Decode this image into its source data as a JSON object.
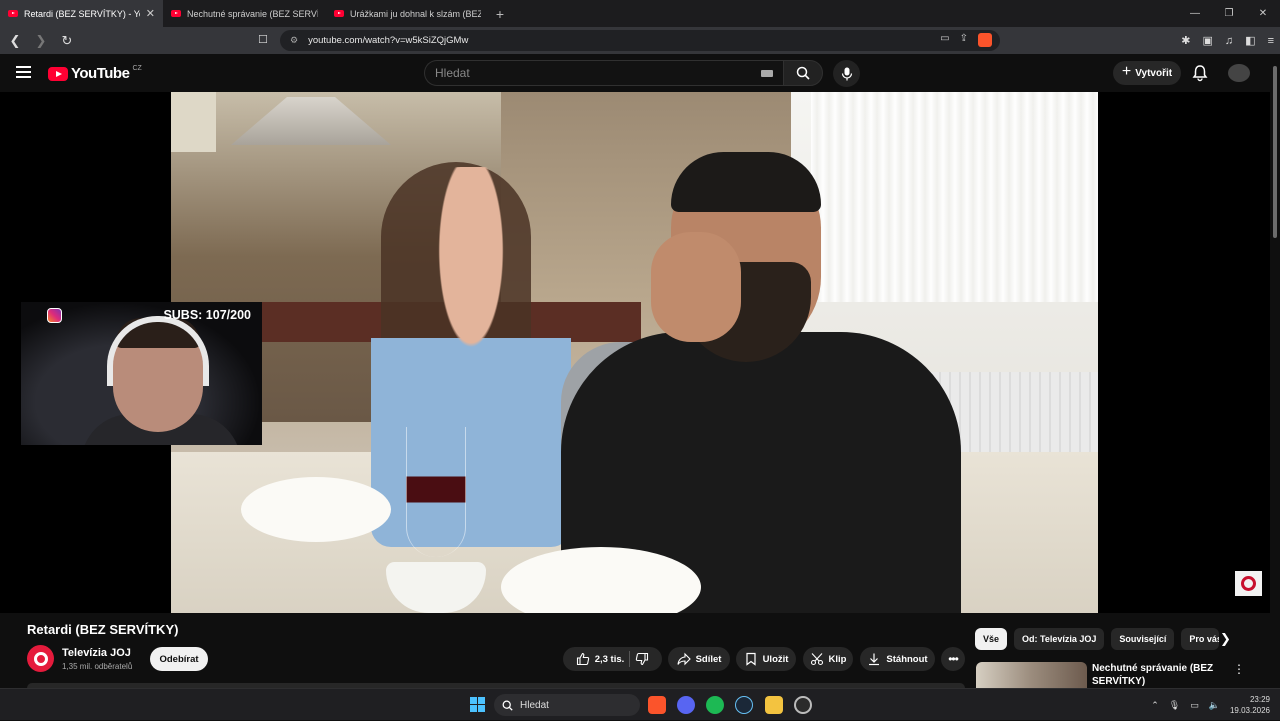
{
  "browser": {
    "tabs": [
      {
        "label": "Retardi (BEZ SERVÍTKY) - YouTube",
        "active": true
      },
      {
        "label": "Nechutné správanie (BEZ SERVÍTKY)",
        "active": false
      },
      {
        "label": "Urážkami ju dohnal k slzám (BEZ SERVÍTKY)",
        "active": false
      }
    ],
    "url": "youtube.com/watch?v=w5kSiZQjGMw",
    "brand_color": "#ff0033"
  },
  "youtube_header": {
    "logo_text": "YouTube",
    "region": "CZ",
    "search_placeholder": "Hledat",
    "create_label": "Vytvořit"
  },
  "player": {
    "overlay_subs": "SUBS: 107/200"
  },
  "video_info": {
    "title": "Retardi (BEZ SERVÍTKY)",
    "channel_name": "Televízia JOJ",
    "channel_subs": "1,35 mil. odběratelů",
    "subscribe_label": "Odebírat",
    "like_count": "2,3 tis.",
    "share_label": "Sdílet",
    "save_label": "Uložit",
    "clip_label": "Klip",
    "download_label": "Stáhnout"
  },
  "sidebar": {
    "chips": [
      "Vše",
      "Od: Televízia JOJ",
      "Související",
      "Pro vás"
    ],
    "recommended": [
      {
        "title": "Nechutné správanie (BEZ SERVÍTKY)"
      }
    ]
  },
  "taskbar": {
    "search_label": "Hledat",
    "time": "23:29",
    "date": "19.03.2026"
  }
}
